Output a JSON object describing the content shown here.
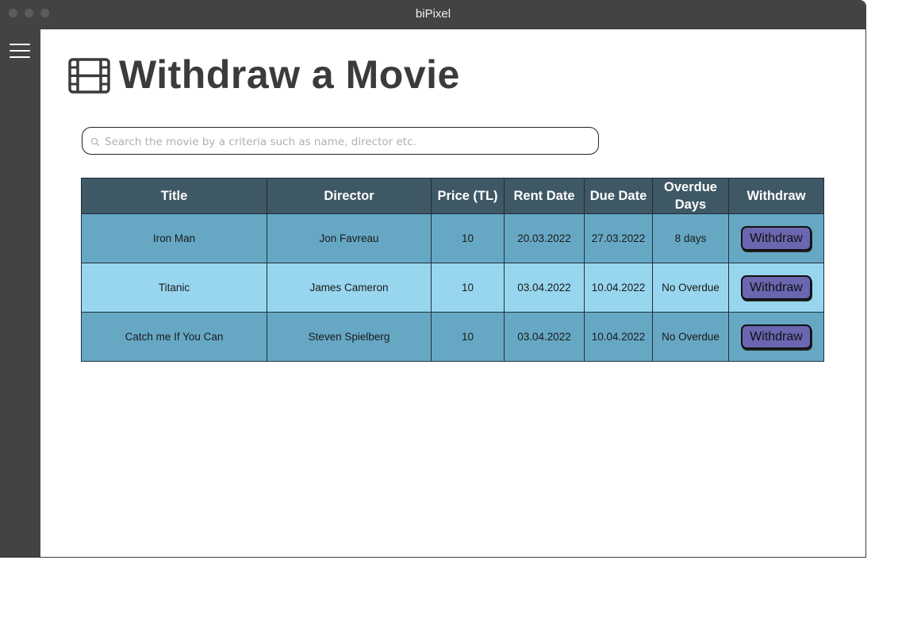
{
  "app": {
    "title": "biPixel"
  },
  "page": {
    "title": "Withdraw a Movie"
  },
  "search": {
    "placeholder": "Search the movie by a criteria such as name, director etc."
  },
  "table": {
    "columns": [
      "Title",
      "Director",
      "Price (TL)",
      "Rent Date",
      "Due Date",
      "Overdue Days",
      "Withdraw"
    ],
    "rows": [
      {
        "title": "Iron Man",
        "director": "Jon Favreau",
        "price": "10",
        "rent_date": "20.03.2022",
        "due_date": "27.03.2022",
        "overdue": "8 days",
        "action": "Withdraw"
      },
      {
        "title": "Titanic",
        "director": "James Cameron",
        "price": "10",
        "rent_date": "03.04.2022",
        "due_date": "10.04.2022",
        "overdue": "No Overdue",
        "action": "Withdraw"
      },
      {
        "title": "Catch me If You Can",
        "director": "Steven Spielberg",
        "price": "10",
        "rent_date": "03.04.2022",
        "due_date": "10.04.2022",
        "overdue": "No Overdue",
        "action": "Withdraw"
      }
    ]
  },
  "icons": {
    "menu": "hamburger-menu-icon",
    "title": "film-icon",
    "search": "search-icon"
  },
  "colors": {
    "chrome": "#434343",
    "header": "#3f5865",
    "row_dark": "#66a8c4",
    "row_light": "#98d6ef",
    "button": "#6a66b0"
  }
}
